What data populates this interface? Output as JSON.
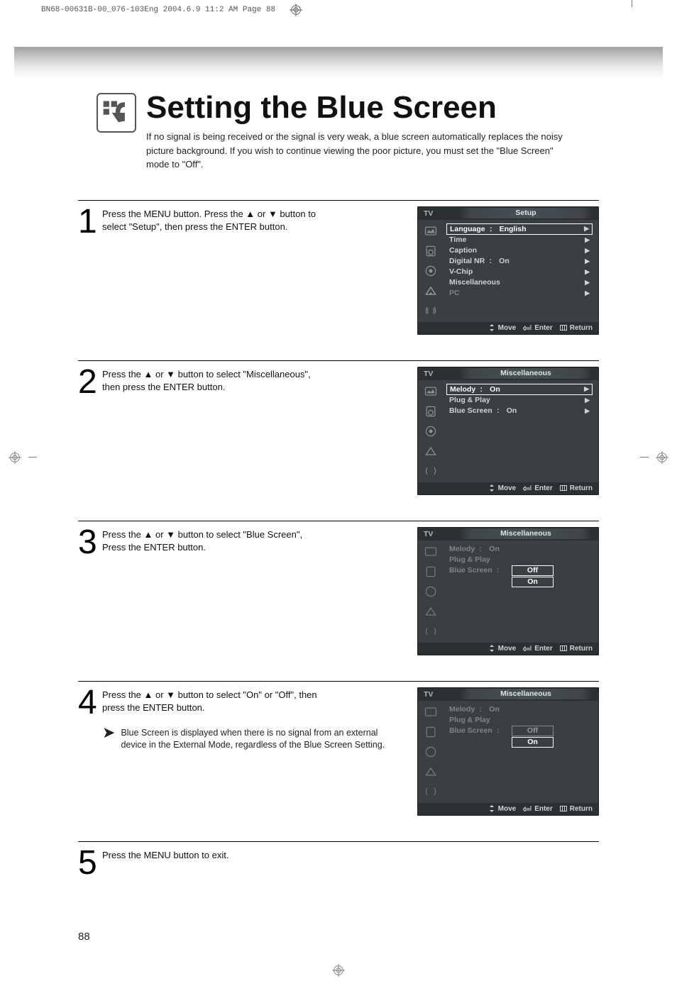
{
  "meta": {
    "docref": "BN68-00631B-00_076-103Eng  2004.6.9  11:2 AM  Page 88"
  },
  "header": {
    "title": "Setting the Blue Screen",
    "intro": "If no signal is being received or the signal is very weak, a blue screen automatically replaces the noisy picture background. If you wish to continue viewing the poor picture, you must set the \"Blue Screen\" mode to \"Off\"."
  },
  "steps": {
    "s1": {
      "num": "1",
      "text": "Press the MENU button. Press the ▲ or ▼ button to select \"Setup\", then press the ENTER button."
    },
    "s2": {
      "num": "2",
      "text": "Press the ▲ or ▼ button to select \"Miscellaneous\", then press the ENTER button."
    },
    "s3": {
      "num": "3",
      "text": "Press the ▲ or ▼ button to select \"Blue Screen\", Press the ENTER button."
    },
    "s4": {
      "num": "4",
      "text": "Press the ▲ or ▼ button to select \"On\" or \"Off\", then press the ENTER button.",
      "note": "Blue Screen is displayed when there is  no signal from an external device in the External Mode, regardless of the Blue Screen Setting."
    },
    "s5": {
      "num": "5",
      "text": "Press the MENU button to exit."
    }
  },
  "osd_common": {
    "tv": "TV",
    "move": "Move",
    "enter": "Enter",
    "return": "Return"
  },
  "osd1": {
    "title": "Setup",
    "rows": {
      "language": {
        "label": "Language",
        "val": "English"
      },
      "time": {
        "label": "Time"
      },
      "caption": {
        "label": "Caption"
      },
      "digitalnr": {
        "label": "Digital NR",
        "val": "On"
      },
      "vchip": {
        "label": "V-Chip"
      },
      "misc": {
        "label": "Miscellaneous"
      },
      "pc": {
        "label": "PC"
      }
    }
  },
  "osd2": {
    "title": "Miscellaneous",
    "rows": {
      "melody": {
        "label": "Melody",
        "val": "On"
      },
      "plugplay": {
        "label": "Plug & Play"
      },
      "bluescreen": {
        "label": "Blue Screen",
        "val": "On"
      }
    }
  },
  "osd3": {
    "title": "Miscellaneous",
    "rows": {
      "melody": {
        "label": "Melody",
        "val": "On"
      },
      "plugplay": {
        "label": "Plug & Play"
      },
      "bluescreen": {
        "label": "Blue Screen"
      },
      "off": "Off",
      "on": "On"
    }
  },
  "osd4": {
    "title": "Miscellaneous",
    "rows": {
      "melody": {
        "label": "Melody",
        "val": "On"
      },
      "plugplay": {
        "label": "Plug & Play"
      },
      "bluescreen": {
        "label": "Blue Screen"
      },
      "off": "Off",
      "on": "On"
    }
  },
  "page_number": "88"
}
